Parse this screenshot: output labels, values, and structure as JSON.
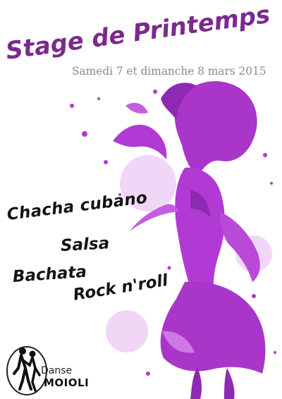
{
  "poster": {
    "title": "Stage de Printemps",
    "subtitle": "Samedi 7 et dimanche 8 mars 2015",
    "dances": [
      "Chacha cubano",
      "Salsa",
      "Bachata",
      "Rock n'roll"
    ],
    "brand": {
      "top": "Danse",
      "main": "MOIOLI"
    }
  },
  "colors": {
    "title": "#7b2a8c",
    "accent": "#b23ad4",
    "accent_light": "#d88ce8",
    "text": "#141414",
    "subtitle": "#8a8a8a"
  }
}
